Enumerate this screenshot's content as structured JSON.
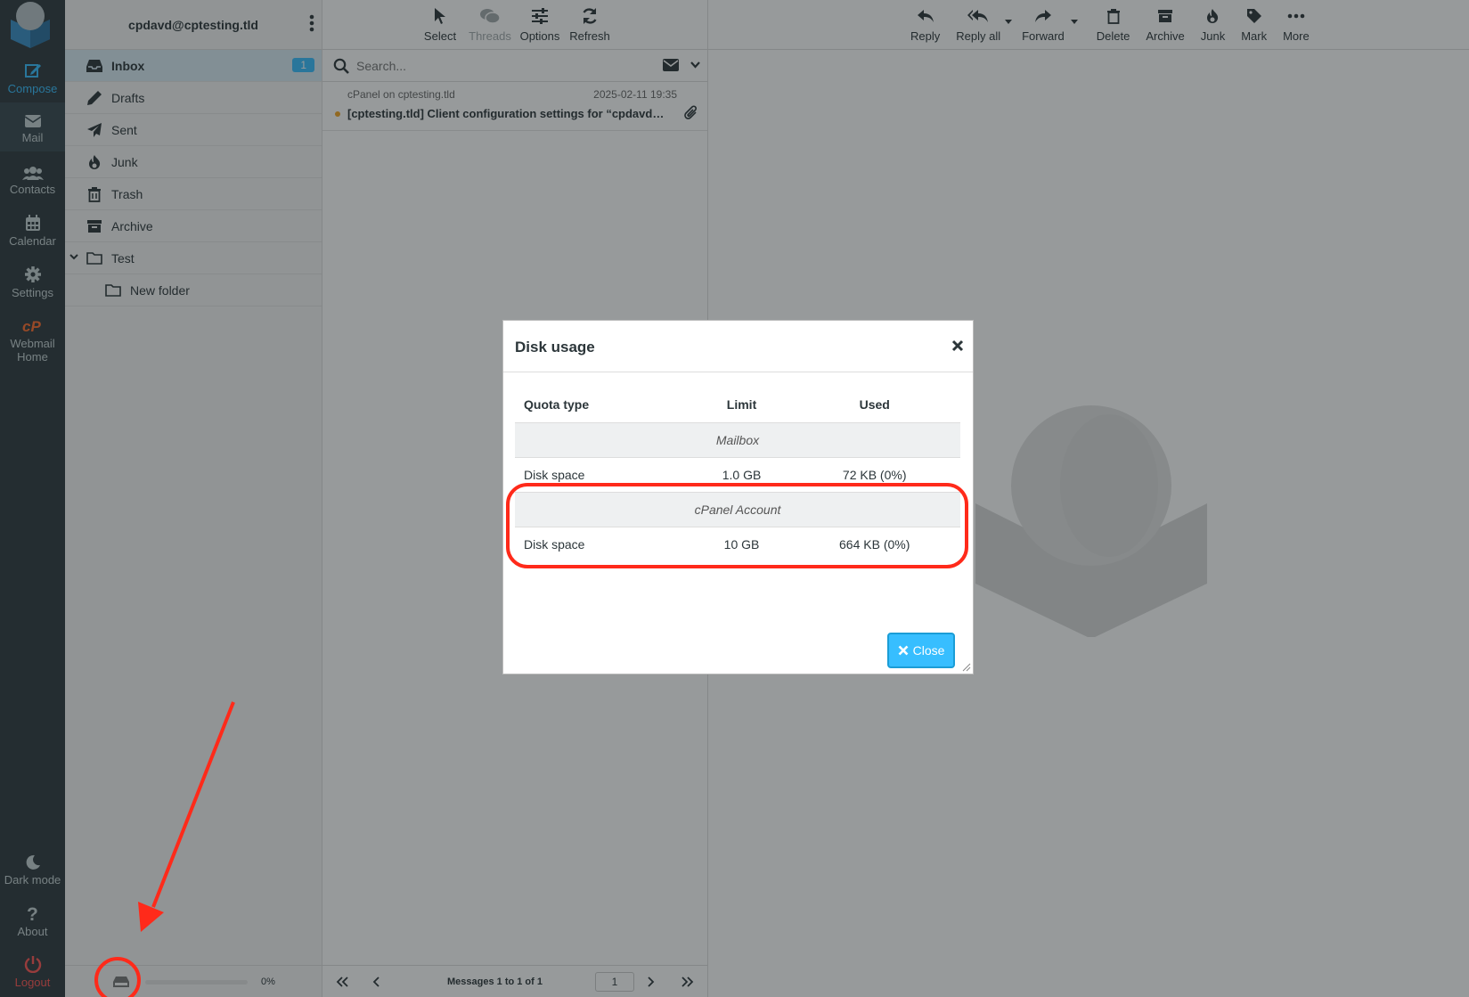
{
  "nav": {
    "items": [
      {
        "label": "Compose",
        "icon": "compose-icon"
      },
      {
        "label": "Mail",
        "icon": "envelope-icon"
      },
      {
        "label": "Contacts",
        "icon": "users-icon"
      },
      {
        "label": "Calendar",
        "icon": "calendar-icon"
      },
      {
        "label": "Settings",
        "icon": "gear-icon"
      },
      {
        "label": "Webmail Home",
        "icon": "cpanel-icon"
      }
    ],
    "bottom": [
      {
        "label": "Dark mode",
        "icon": "moon-icon"
      },
      {
        "label": "About",
        "icon": "question-icon"
      },
      {
        "label": "Logout",
        "icon": "power-icon"
      }
    ],
    "colors": {
      "background": "#2f3a3f",
      "active": "#37beff",
      "logout": "#ff5552"
    }
  },
  "account": {
    "email": "cpdavd@cptesting.tld"
  },
  "folders": [
    {
      "name": "Inbox",
      "unread": "1",
      "icon": "inbox-icon"
    },
    {
      "name": "Drafts",
      "icon": "pencil-icon"
    },
    {
      "name": "Sent",
      "icon": "paper-plane-icon"
    },
    {
      "name": "Junk",
      "icon": "fire-icon"
    },
    {
      "name": "Trash",
      "icon": "trash-icon"
    },
    {
      "name": "Archive",
      "icon": "archive-icon"
    },
    {
      "name": "Test",
      "icon": "folder-icon"
    },
    {
      "name": "New folder",
      "icon": "folder-icon"
    }
  ],
  "quota": {
    "percent_label": "0%",
    "used_fraction": 0.0
  },
  "list_toolbar": {
    "select": "Select",
    "threads": "Threads",
    "options": "Options",
    "refresh": "Refresh"
  },
  "search": {
    "placeholder": "Search..."
  },
  "messages": [
    {
      "from": "cPanel on cptesting.tld",
      "date": "2025-02-11 19:35",
      "subject": "[cptesting.tld] Client configuration settings for “cpdavd@cptesting.tld”"
    }
  ],
  "pager": {
    "text": "Messages 1 to 1 of 1",
    "page": "1"
  },
  "preview_toolbar": {
    "reply": "Reply",
    "reply_all": "Reply all",
    "forward": "Forward",
    "delete": "Delete",
    "archive": "Archive",
    "junk": "Junk",
    "mark": "Mark",
    "more": "More"
  },
  "dialog": {
    "title": "Disk usage",
    "columns": [
      "Quota type",
      "Limit",
      "Used"
    ],
    "groups": [
      {
        "name": "Mailbox",
        "rows": [
          {
            "type": "Disk space",
            "limit": "1.0 GB",
            "used": "72 KB (0%)"
          }
        ]
      },
      {
        "name": "cPanel Account",
        "rows": [
          {
            "type": "Disk space",
            "limit": "10 GB",
            "used": "664 KB (0%)"
          }
        ]
      }
    ],
    "close_label": "Close",
    "accent": "#37beff"
  },
  "annotation_color": "#ff2a1a"
}
